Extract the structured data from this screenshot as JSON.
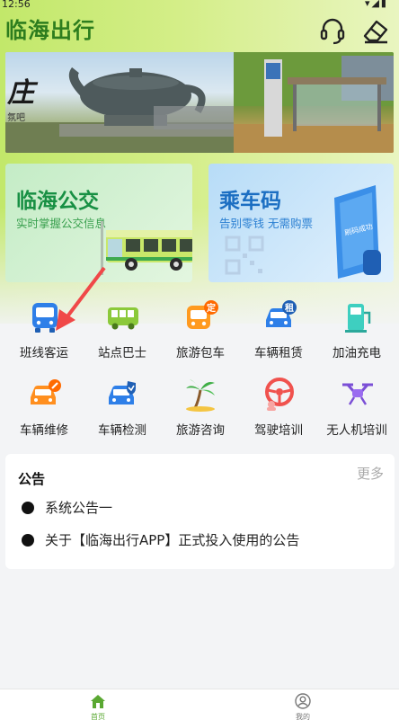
{
  "status_bar": {
    "time": "12:56",
    "icons": "▾◢▮"
  },
  "app": {
    "title": "临海出行",
    "brand_color": "#2d7d1e"
  },
  "header": {
    "support_icon": "headset-icon",
    "clear_icon": "eraser-icon"
  },
  "banner": {
    "caption_big": "庄",
    "caption_small": "氛吧"
  },
  "cards": [
    {
      "title": "临海公交",
      "subtitle": "实时掌握公交信息",
      "color": "#189044"
    },
    {
      "title": "乘车码",
      "subtitle": "告别零钱  无需购票",
      "color": "#1b6ec2"
    }
  ],
  "services": [
    {
      "label": "班线客运",
      "icon": "coach-bus-icon"
    },
    {
      "label": "站点巴士",
      "icon": "station-bus-icon"
    },
    {
      "label": "旅游包车",
      "icon": "charter-bus-icon",
      "badge": "定"
    },
    {
      "label": "车辆租赁",
      "icon": "car-rental-icon",
      "badge": "租"
    },
    {
      "label": "加油充电",
      "icon": "charging-station-icon"
    },
    {
      "label": "车辆维修",
      "icon": "car-repair-icon"
    },
    {
      "label": "车辆检测",
      "icon": "car-inspection-icon"
    },
    {
      "label": "旅游咨询",
      "icon": "palm-tree-icon"
    },
    {
      "label": "驾驶培训",
      "icon": "steering-wheel-icon"
    },
    {
      "label": "无人机培训",
      "icon": "drone-icon"
    }
  ],
  "notice": {
    "title": "公告",
    "more": "更多",
    "items": [
      "系统公告一",
      "关于【临海出行APP】正式投入使用的公告"
    ]
  },
  "tabbar": {
    "home": {
      "label": "首页",
      "active_color": "#5aa832"
    },
    "mine": {
      "label": "我的"
    }
  }
}
